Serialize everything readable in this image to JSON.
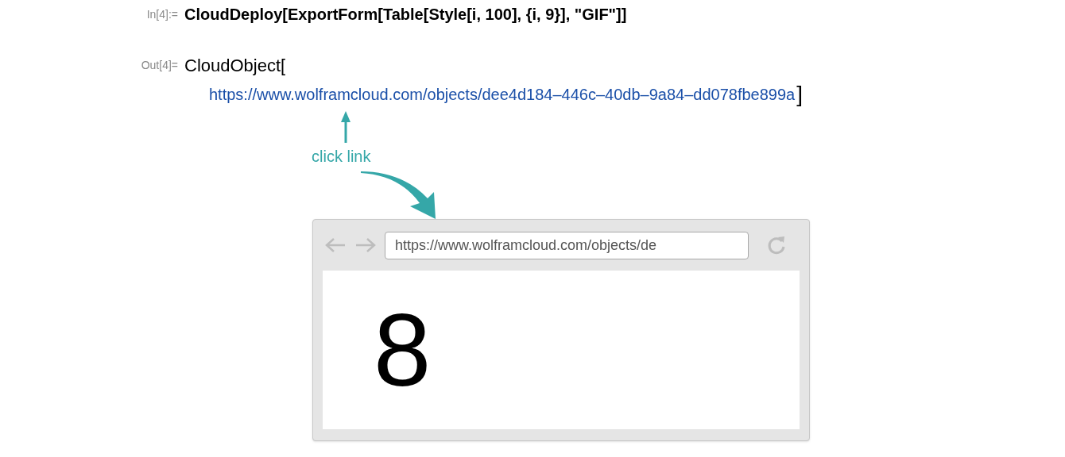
{
  "input": {
    "label": "In[4]:=",
    "code": "CloudDeploy[ExportForm[Table[Style[i, 100], {i, 9}], \"GIF\"]]"
  },
  "output": {
    "label": "Out[4]=",
    "head": "CloudObject[",
    "url": "https://www.wolframcloud.com/objects/dee4d184–446c–40db–9a84–dd078fbe899a",
    "close": "]"
  },
  "annotation": {
    "text": "click link"
  },
  "browser": {
    "address": "https://www.wolframcloud.com/objects/de",
    "content": "8"
  }
}
